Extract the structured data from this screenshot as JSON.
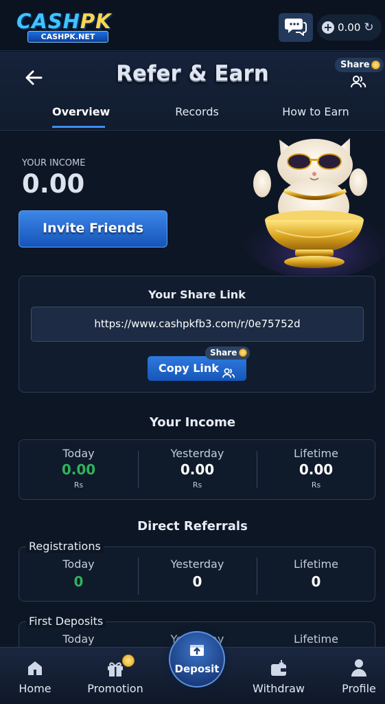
{
  "topbar": {
    "logo_main_a": "CASH",
    "logo_main_b": "PK",
    "logo_sub": "CASHPK.NET",
    "balance": "0.00"
  },
  "header": {
    "title": "Refer & Earn",
    "share_label": "Share"
  },
  "tabs": [
    {
      "label": "Overview",
      "active": true
    },
    {
      "label": "Records",
      "active": false
    },
    {
      "label": "How to Earn",
      "active": false
    }
  ],
  "hero": {
    "income_label": "YOUR INCOME",
    "income_value": "0.00",
    "invite_label": "Invite Friends"
  },
  "share_link": {
    "title": "Your Share Link",
    "url": "https://www.cashpkfb3.com/r/0e75752d",
    "copy_label": "Copy Link",
    "share_badge": "Share"
  },
  "your_income": {
    "title": "Your Income",
    "cols": [
      {
        "label": "Today",
        "value": "0.00",
        "unit": "Rs"
      },
      {
        "label": "Yesterday",
        "value": "0.00",
        "unit": "Rs"
      },
      {
        "label": "Lifetime",
        "value": "0.00",
        "unit": "Rs"
      }
    ]
  },
  "direct_referrals": {
    "title": "Direct Referrals",
    "registrations": {
      "legend": "Registrations",
      "cols": [
        {
          "label": "Today",
          "value": "0"
        },
        {
          "label": "Yesterday",
          "value": "0"
        },
        {
          "label": "Lifetime",
          "value": "0"
        }
      ]
    },
    "first_deposits": {
      "legend": "First Deposits",
      "cols": [
        {
          "label": "Today"
        },
        {
          "label": "Yesterday"
        },
        {
          "label": "Lifetime"
        }
      ]
    }
  },
  "bottom_nav": {
    "home": "Home",
    "promotion": "Promotion",
    "deposit": "Deposit",
    "withdraw": "Withdraw",
    "profile": "Profile"
  },
  "colors": {
    "accent": "#3f8df2",
    "positive": "#2fb35a",
    "background": "#0d1624"
  }
}
